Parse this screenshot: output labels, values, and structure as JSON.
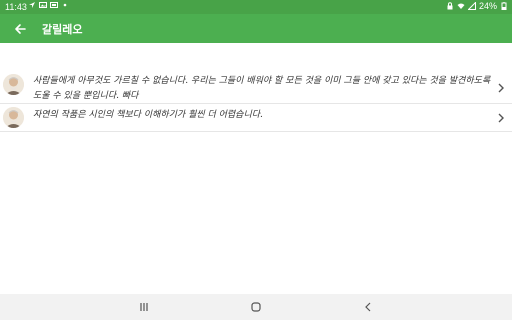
{
  "status_bar": {
    "time": "11:43",
    "battery": "24%",
    "left_icons": [
      "navigation-icon",
      "gallery-icon",
      "image-icon",
      "dot-icon"
    ],
    "right_icons": [
      "lock-icon",
      "wifi-icon",
      "signal-icon",
      "battery-icon"
    ]
  },
  "app_bar": {
    "title": "갈릴레오",
    "back_icon": "arrow-left-icon",
    "color": "#4caf50"
  },
  "quotes": [
    {
      "text": "사람들에게 아무것도 가르칠 수 없습니다. 우리는 그들이 배워야 할 모든 것을 이미 그들 안에 갖고 있다는 것을 발견하도록 도울 수 있을 뿐입니다. 빠다",
      "icon": "chevron-right-icon"
    },
    {
      "text": "자연의 작품은 시인의 책보다 이해하기가 훨씬 더 어렵습니다.",
      "icon": "chevron-right-icon"
    }
  ],
  "nav_bar": {
    "items": [
      "recents-icon",
      "home-icon",
      "back-icon"
    ]
  }
}
